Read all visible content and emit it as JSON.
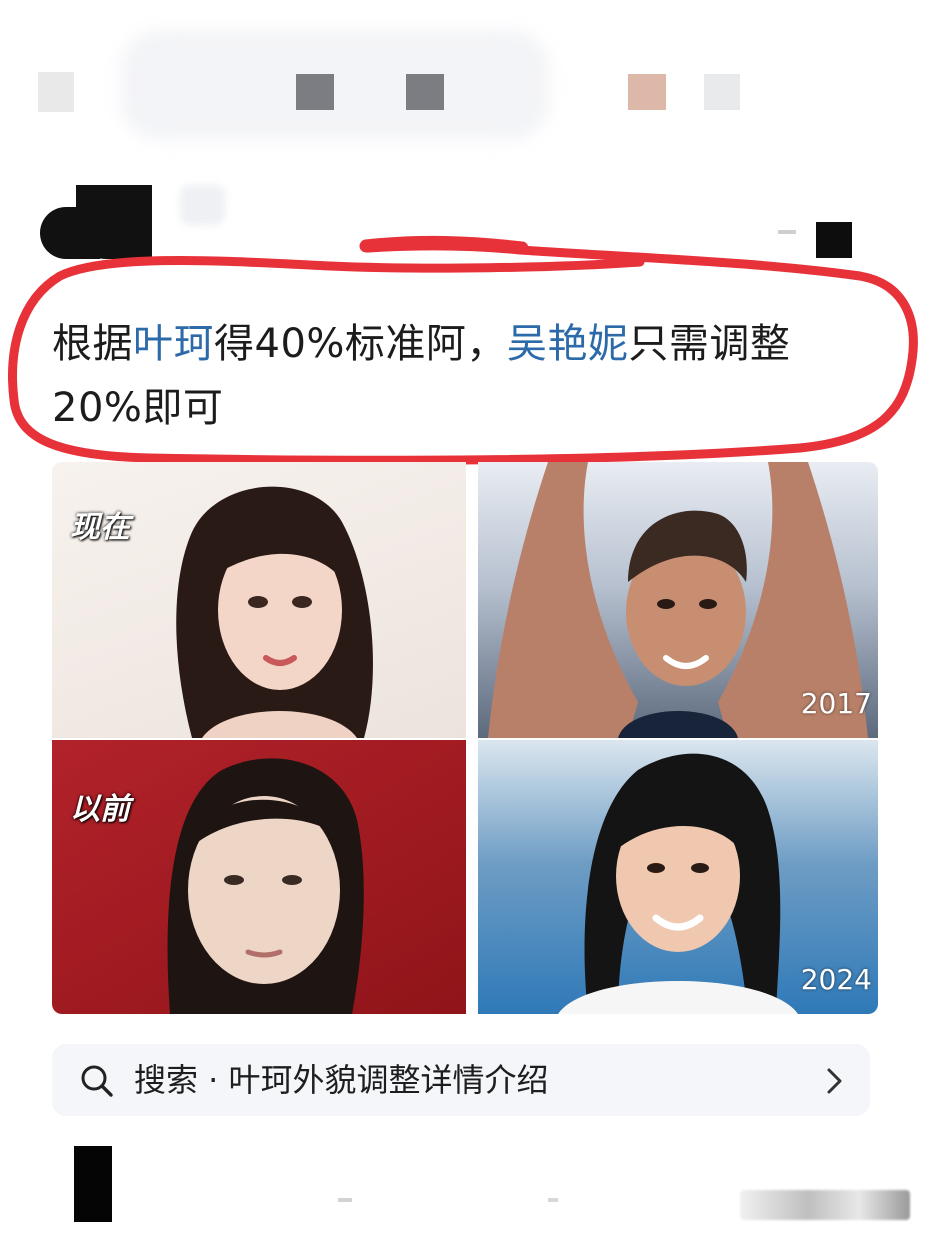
{
  "post": {
    "text_parts": {
      "p1": "根据",
      "h1": "叶珂",
      "p2": "得40%标准阿，",
      "h2": "吴艳妮",
      "p3": "只需调整",
      "p4": "20%即可"
    },
    "highlight_color": "#2c6aa9",
    "annotation_circle_color": "#e8323a"
  },
  "images": {
    "top_left_label": "现在",
    "bottom_left_label": "以前",
    "top_right_year": "2017",
    "bottom_right_year": "2024"
  },
  "search": {
    "label": "搜索 · 叶珂外貌调整详情介绍",
    "icon": "search-icon",
    "chevron": "chevron-right-icon"
  }
}
